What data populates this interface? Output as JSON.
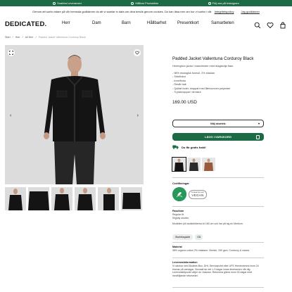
{
  "topbar": {
    "usps": [
      "Snabba Leveranser",
      "Hållbar Produktion",
      "Följ oss på Instagram"
    ]
  },
  "cookie": {
    "text": "Genom att surfa vidare på vår hemsida godkänner du att vi samlar in data om dina besök genom cookies. Du kan läsa mer om hur vi surfar i vår",
    "link": "Integritetspolicy",
    "accept": "Jag godkänner"
  },
  "header": {
    "logo": "DEDICATED.",
    "nav": [
      "Herr",
      "Dam",
      "Barn",
      "Hållbarhet",
      "Presentkort",
      "Samarbeten"
    ]
  },
  "breadcrumb": [
    "Start",
    "Herr",
    "All Herr",
    "Padded Jacket Vallentuna Corduroy Black"
  ],
  "product": {
    "title": "Padded Jacket Vallentuna Corduroy Black",
    "subtitle": "Herringbon jacka i manchester med dragkedja fram.",
    "bullets": [
      "- 98% ekologisk bomull, 2% elastan",
      "- Sidofickor",
      "- Innerficka",
      "- Resår bak",
      "- Quiltat foder, stoppat med återvunnen polyester",
      "- Tryckknappar i ärmslut"
    ],
    "price": "169.00 USD",
    "size_placeholder": "Välj storlek:",
    "add_to_cart": "LÄGG I VARUKORG",
    "shipping": "Du får gratis frakt!"
  },
  "certs": {
    "heading": "Certifieringar",
    "cert1": "GLOBAL ORGANIC TEXTILE STANDARD",
    "cert2_top": "PETA-APPROVED",
    "cert2_main": "VEGAN"
  },
  "fit": {
    "heading": "Passform",
    "lines": [
      "Regular fit.",
      "Slightly shorter."
    ],
    "model": "Modellen på studiobilderna är 180 cm och har på sig en Medium.",
    "guide_label": "Storleksguide",
    "guide_badge": "Gå"
  },
  "material": {
    "heading": "Material",
    "text": "98% organic cotton 2% elastane. Stretch. 290 gsm. Corduroy & waxes."
  },
  "delivery": {
    "heading": "Leveransinformation",
    "text": "Vi skickar med Budbee-Box, DHL Servicepoint eller UPS Hemleverans inom 24 timmar på vardagar. Normalt tar det 1-3 dagar innan leveransen når dig. Leveranstidpunkt väljer du i kassan. Returnera gärna inom 30 dagar med medföljande retursedel."
  },
  "colors": {
    "accent": "#1d6b44",
    "background_image": "#dcdcdc",
    "jacket": "#111111"
  }
}
